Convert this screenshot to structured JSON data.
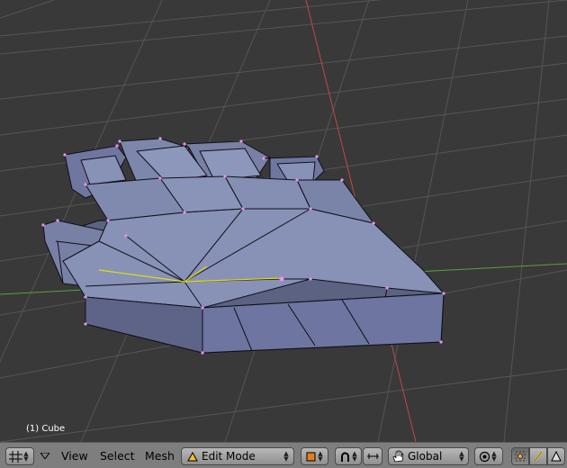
{
  "viewport": {
    "object_label": "(1) Cube",
    "colors": {
      "background": "#393939",
      "grid": "#555555",
      "x_axis": "#c04848",
      "y_axis": "#5aa13b",
      "mesh_fill": "#7d86ab",
      "mesh_edge": "#101018",
      "vertex": "#f090f0",
      "selected_edge": "#e0e000"
    }
  },
  "header": {
    "editor_type_icon": "3d-view-grid-icon",
    "menus": [
      "View",
      "Select",
      "Mesh"
    ],
    "mode": {
      "icon": "edit-mode-triangle-icon",
      "label": "Edit Mode"
    },
    "shading_icon": "solid-shading-icon",
    "pivot_icon": "pivot-horseshoe-icon",
    "manipulator_icon": "transform-manipulator-icon",
    "orientation": {
      "icon": "hand-icon",
      "label": "Global"
    },
    "proportional_icon": "proportional-edit-icon",
    "select_modes": [
      "vertex-select-icon",
      "edge-select-icon",
      "face-select-icon"
    ]
  }
}
